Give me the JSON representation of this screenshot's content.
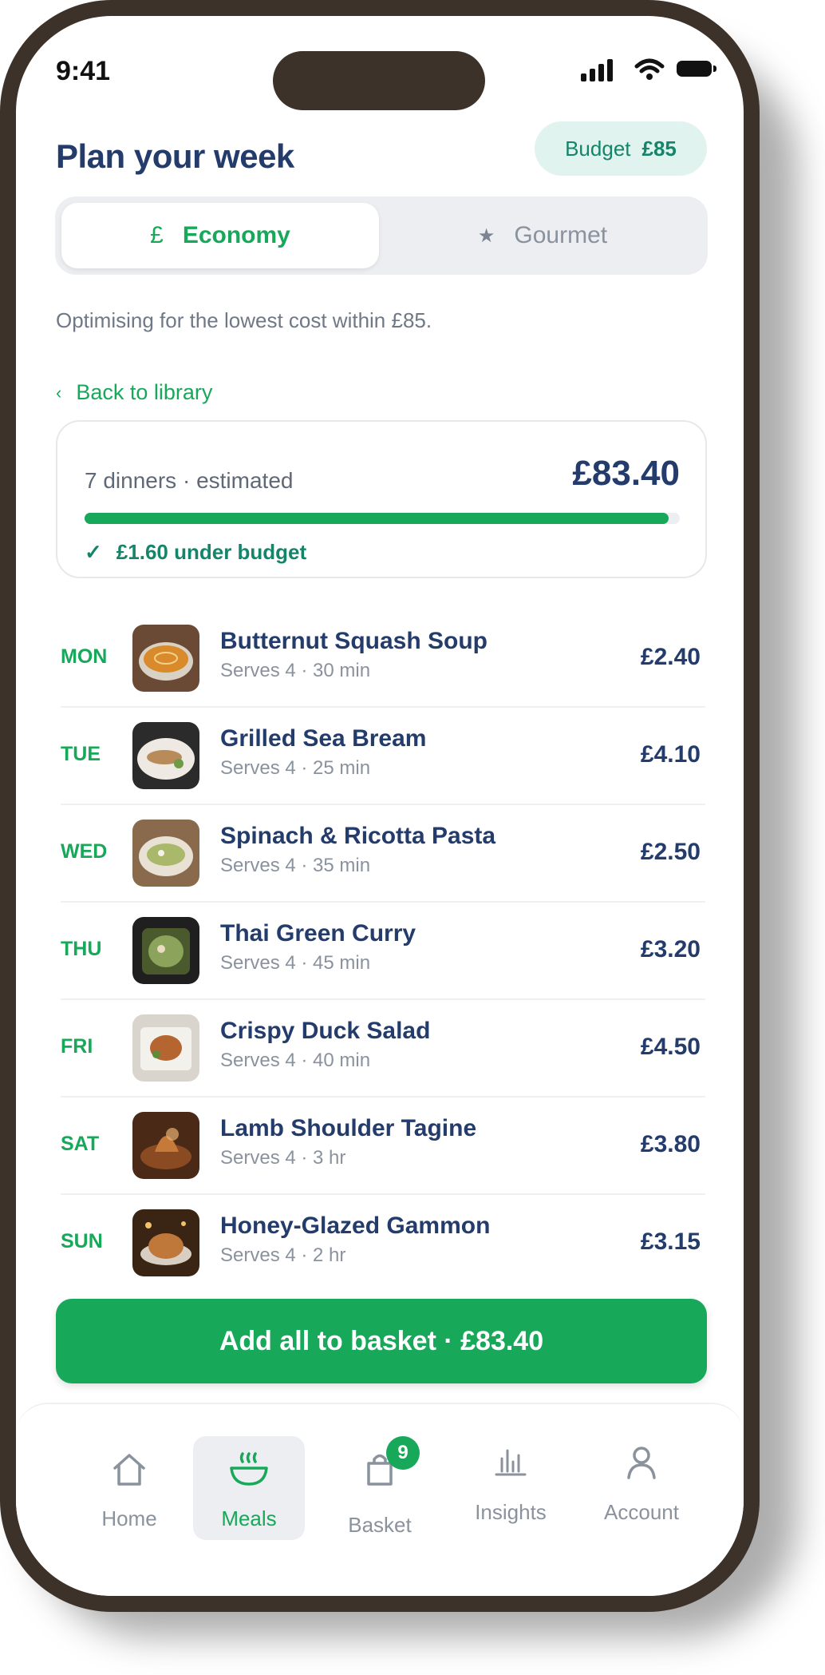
{
  "status_bar": {
    "time": "9:41"
  },
  "header": {
    "title": "Plan your week",
    "budget_label": "Budget",
    "budget_value": "£85"
  },
  "mode_toggle": {
    "economy": {
      "icon": "£",
      "label": "Economy"
    },
    "gourmet": {
      "icon": "★",
      "label": "Gourmet"
    },
    "selected": "economy"
  },
  "subtitle": "Optimising for the lowest cost within £85.",
  "back_link": {
    "label": "Back to library"
  },
  "summary": {
    "label": "7 dinners · estimated",
    "total": "£83.40",
    "progress_fraction": 0.981,
    "under_budget": "£1.60 under budget"
  },
  "meals": [
    {
      "day": "MON",
      "name": "Butternut Squash Soup",
      "meta": "Serves 4 · 30 min",
      "price": "£2.40"
    },
    {
      "day": "TUE",
      "name": "Grilled Sea Bream",
      "meta": "Serves 4 · 25 min",
      "price": "£4.10"
    },
    {
      "day": "WED",
      "name": "Spinach & Ricotta Pasta",
      "meta": "Serves 4 · 35 min",
      "price": "£2.50"
    },
    {
      "day": "THU",
      "name": "Thai Green Curry",
      "meta": "Serves 4 · 45 min",
      "price": "£3.20"
    },
    {
      "day": "FRI",
      "name": "Crispy Duck Salad",
      "meta": "Serves 4 · 40 min",
      "price": "£4.50"
    },
    {
      "day": "SAT",
      "name": "Lamb Shoulder Tagine",
      "meta": "Serves 4 · 3 hr",
      "price": "£3.80"
    },
    {
      "day": "SUN",
      "name": "Honey-Glazed Gammon",
      "meta": "Serves 4 · 2 hr",
      "price": "£3.15"
    }
  ],
  "cta": {
    "label": "Add all to basket · £83.40"
  },
  "tabbar": {
    "home": "Home",
    "meals": "Meals",
    "basket": "Basket",
    "basket_badge": "9",
    "insights": "Insights",
    "account": "Account",
    "active": "meals"
  },
  "colors": {
    "accent": "#17a85a",
    "navy": "#243c6c",
    "frame": "#3d3229",
    "pill_bg": "#e1f3ee"
  }
}
